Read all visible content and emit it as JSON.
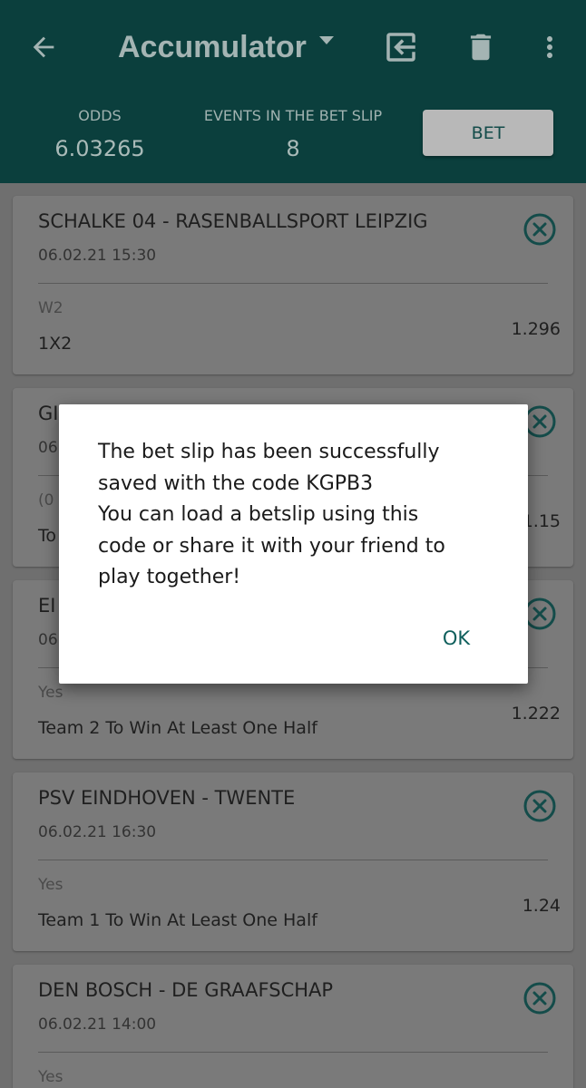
{
  "appbar": {
    "title": "Accumulator",
    "odds_label": "ODDS",
    "odds_value": "6.03265",
    "events_label": "EVENTS IN THE BET SLIP",
    "events_value": "8",
    "bet_label": "BET"
  },
  "cards": [
    {
      "match": "SCHALKE 04 - RASENBALLSPORT LEIPZIG",
      "date": "06.02.21 15:30",
      "pick": "W2",
      "market": "1X2",
      "odd": "1.296"
    },
    {
      "match": "GI",
      "date": "06",
      "pick": "(0",
      "market": "To",
      "odd": "1.15"
    },
    {
      "match": "EI",
      "date": "06",
      "pick": "Yes",
      "market": "Team 2 To Win At Least One Half",
      "odd": "1.222"
    },
    {
      "match": "PSV EINDHOVEN - TWENTE",
      "date": "06.02.21 16:30",
      "pick": "Yes",
      "market": "Team 1 To Win At Least One Half",
      "odd": "1.24"
    },
    {
      "match": "DEN BOSCH - DE GRAAFSCHAP",
      "date": "06.02.21 14:00",
      "pick": "Yes",
      "market": "",
      "odd": ""
    }
  ],
  "dialog": {
    "lines": [
      "The bet slip has been successfully",
      "saved with the code KGPB3",
      "You can load a betslip using this",
      "code or share it with your friend to",
      "play together!"
    ],
    "ok_label": "OK"
  },
  "colors": {
    "appbar": "#0b3f3d",
    "accent": "#0f5f5c",
    "remove_icon": "#144c4a",
    "dim_background": "#6f6f6f"
  },
  "icons": {
    "back": "arrow-left-icon",
    "dropdown": "caret-down-icon",
    "export": "exit-icon",
    "trash": "trash-icon",
    "more": "more-vertical-icon",
    "remove": "close-circle-icon"
  }
}
